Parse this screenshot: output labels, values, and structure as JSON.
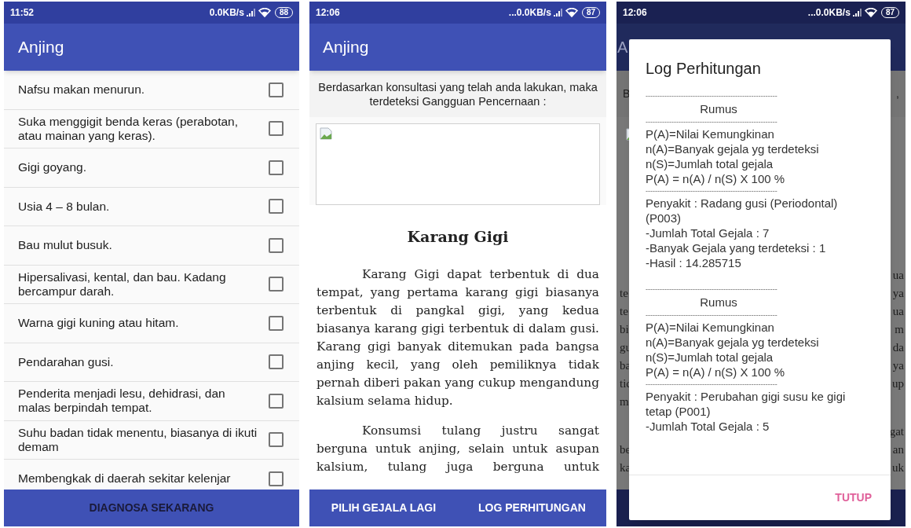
{
  "phones": [
    {
      "kind": "symptoms",
      "status": {
        "time": "11:52",
        "speed": "0.0KB/s",
        "battery": "88"
      },
      "title": "Anjing",
      "symptoms": [
        {
          "text": "Nafsu makan menurun.",
          "checked": false
        },
        {
          "text": "Suka menggigit benda keras (perabotan, atau mainan yang keras).",
          "checked": false
        },
        {
          "text": "Gigi goyang.",
          "checked": false
        },
        {
          "text": "Usia 4 – 8 bulan.",
          "checked": false
        },
        {
          "text": "Bau mulut busuk.",
          "checked": false
        },
        {
          "text": "Hipersalivasi, kental, dan bau. Kadang bercampur darah.",
          "checked": false
        },
        {
          "text": "Warna gigi kuning atau hitam.",
          "checked": false
        },
        {
          "text": "Pendarahan gusi.",
          "checked": false
        },
        {
          "text": "Penderita menjadi lesu, dehidrasi, dan malas berpindah tempat.",
          "checked": false
        },
        {
          "text": "Suhu badan tidak menentu, biasanya di ikuti demam",
          "checked": false
        },
        {
          "text": "Membengkak di daerah sekitar kelenjar",
          "checked": false
        }
      ],
      "actions": [
        "DIAGNOSA SEKARANG"
      ]
    },
    {
      "kind": "result",
      "status": {
        "time": "12:06",
        "speed": "...0.0KB/s",
        "battery": "87"
      },
      "title": "Anjing",
      "intro": "Berdasarkan konsultasi yang telah anda lakukan, maka terdeteksi Gangguan Pencernaan :",
      "heading": "Karang Gigi",
      "paragraphs": [
        {
          "text": "Karang Gigi dapat terbentuk di dua tempat, yang pertama karang gigi biasanya terbentuk di pangkal gigi, yang kedua biasanya karang gigi terbentuk di dalam gusi. Karang gigi banyak ditemukan pada bangsa anjing kecil, yang oleh pemiliknya tidak pernah diberi pakan yang cukup mengandung kalsium selama hidup.",
          "continues": false
        },
        {
          "text": "Konsumsi tulang justru sangat berguna untuk anjing, selain untuk asupan kalsium, tulang juga berguna untuk",
          "continues": true
        }
      ],
      "actions": [
        "PILIH GEJALA LAGI",
        "LOG PERHITUNGAN"
      ]
    },
    {
      "kind": "dialog",
      "status": {
        "time": "12:06",
        "speed": "...0.0KB/s",
        "battery": "87"
      },
      "behind": {
        "title": "A",
        "intro_left": "B",
        "intro_right": ",",
        "lines": [
          {
            "right": "ua"
          },
          {
            "left": "te",
            "right": "ya"
          },
          {
            "left": "te",
            "right": "ua"
          },
          {
            "left": "bi",
            "right": "m"
          },
          {
            "left": "gu",
            "right": "da"
          },
          {
            "left": "ba",
            "right": "ya"
          },
          {
            "left": "tic",
            "right": "up"
          },
          {
            "left": "m"
          },
          {
            "right": "gat",
            "break": true
          },
          {
            "left": "be",
            "right": "an"
          },
          {
            "left": "ka",
            "right": "uk"
          }
        ]
      },
      "dialog": {
        "title": "Log Perhitungan",
        "lines": [
          {
            "kind": "rule",
            "text": "--------------------------------------------------------"
          },
          {
            "kind": "heading",
            "text": "Rumus"
          },
          {
            "kind": "rule",
            "text": "--------------------------------------------------------"
          },
          {
            "kind": "text",
            "text": "P(A)=Nilai Kemungkinan"
          },
          {
            "kind": "text",
            "text": "n(A)=Banyak gejala yg terdeteksi"
          },
          {
            "kind": "text",
            "text": "n(S)=Jumlah total gejala"
          },
          {
            "kind": "text",
            "text": "P(A) = n(A) / n(S) X 100 %"
          },
          {
            "kind": "rule",
            "text": "--------------------------------------------------------"
          },
          {
            "kind": "text",
            "text": "Penyakit : Radang gusi (Periodontal) (P003)"
          },
          {
            "kind": "text",
            "text": "-Jumlah Total Gejala : 7"
          },
          {
            "kind": "text",
            "text": "-Banyak Gejala yang terdeteksi : 1"
          },
          {
            "kind": "text",
            "text": "-Hasil : 14.285715"
          },
          {
            "kind": "spacer"
          },
          {
            "kind": "rule",
            "text": "--------------------------------------------------------"
          },
          {
            "kind": "heading",
            "text": "Rumus"
          },
          {
            "kind": "rule",
            "text": "--------------------------------------------------------"
          },
          {
            "kind": "text",
            "text": "P(A)=Nilai Kemungkinan"
          },
          {
            "kind": "text",
            "text": "n(A)=Banyak gejala yg terdeteksi"
          },
          {
            "kind": "text",
            "text": "n(S)=Jumlah total gejala"
          },
          {
            "kind": "text",
            "text": "P(A) = n(A) / n(S) X 100 %"
          },
          {
            "kind": "rule",
            "text": "--------------------------------------------------------"
          },
          {
            "kind": "text",
            "text": "Penyakit : Perubahan gigi susu ke gigi tetap (P001)"
          },
          {
            "kind": "text",
            "text": "-Jumlah Total Gejala : 5"
          }
        ],
        "button": "TUTUP"
      }
    }
  ]
}
